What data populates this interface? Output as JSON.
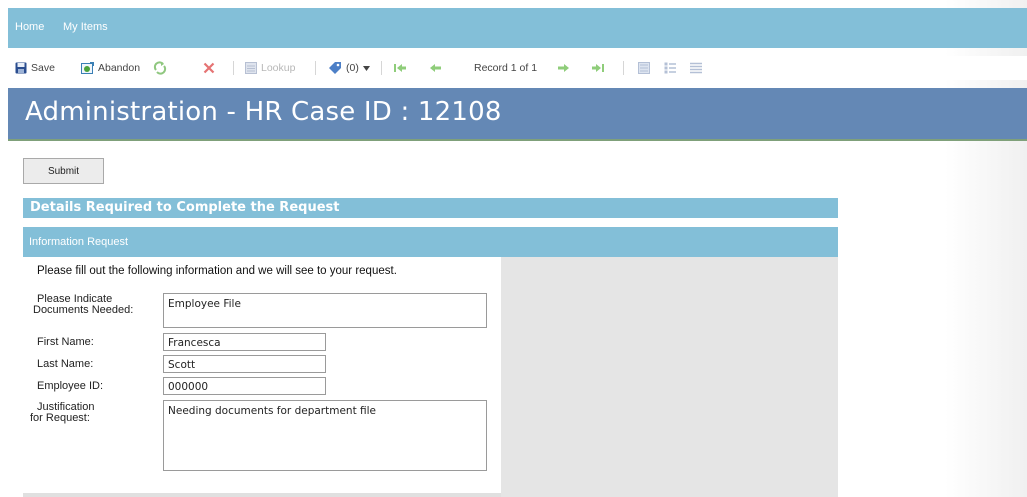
{
  "nav": {
    "home": "Home",
    "my_items": "My Items"
  },
  "toolbar": {
    "save": "Save",
    "abandon": "Abandon",
    "lookup": "Lookup",
    "attachments": "(0)",
    "record": "Record 1 of 1"
  },
  "title": "Administration - HR Case ID : 12108",
  "submit": "Submit",
  "section_title": "Details Required to Complete the Request",
  "subsection_title": "Information Request",
  "form": {
    "intro": "Please fill out the following information and we will see to your request.",
    "documents_label_1": "Please Indicate",
    "documents_label_2": "Documents Needed:",
    "documents_value": "Employee File",
    "first_name_label": "First Name:",
    "first_name_value": "Francesca",
    "last_name_label": "Last Name:",
    "last_name_value": "Scott",
    "employee_id_label": "Employee ID:",
    "employee_id_value": "000000",
    "justification_label_1": "Justification",
    "justification_label_2": "for Request:",
    "justification_value": "Needing documents for department file"
  },
  "colors": {
    "nav_bar": "#83bfd8",
    "title_banner": "#6488b5",
    "section_header": "#83bfd8"
  }
}
